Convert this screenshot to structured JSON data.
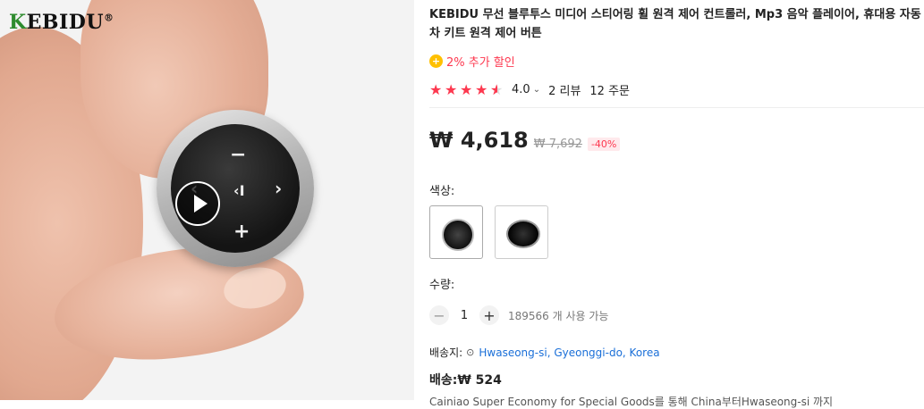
{
  "gallery": {
    "brand_name": "KEBIDU",
    "brand_mark": "®",
    "knob_symbols": {
      "minus": "−",
      "prev": "‹I",
      "next": "›",
      "plus": "+",
      "left": "‹"
    }
  },
  "product": {
    "title": "KEBIDU 무선 블루투스 미디어 스티어링 휠 원격 제어 컨트롤러, Mp3 음악 플레이어, 휴대용 자동차 키트 원격 제어 버튼",
    "coupon_icon": "coin-icon",
    "coupon_text": "2% 추가 할인",
    "rating": {
      "stars": 4.0,
      "score": "4.0",
      "reviews": "2 리뷰",
      "orders": "12 주문"
    },
    "price": {
      "current": "₩ 4,618",
      "original": "₩ 7,692",
      "discount": "-40%"
    },
    "color_label": "색상:",
    "quantity": {
      "label": "수량:",
      "value": "1",
      "available": "189566 개 사용 가능"
    },
    "shipping": {
      "to_label": "배송지:",
      "location": "Hwaseong-si, Gyeonggi-do, Korea",
      "fee": "배송:₩ 524",
      "description": "Cainiao Super Economy for Special Goods를 통해 China부터Hwaseong-si 까지"
    }
  },
  "colors": {
    "accent": "#fd384f",
    "link": "#1a6fd8",
    "coin": "#ffc000"
  }
}
